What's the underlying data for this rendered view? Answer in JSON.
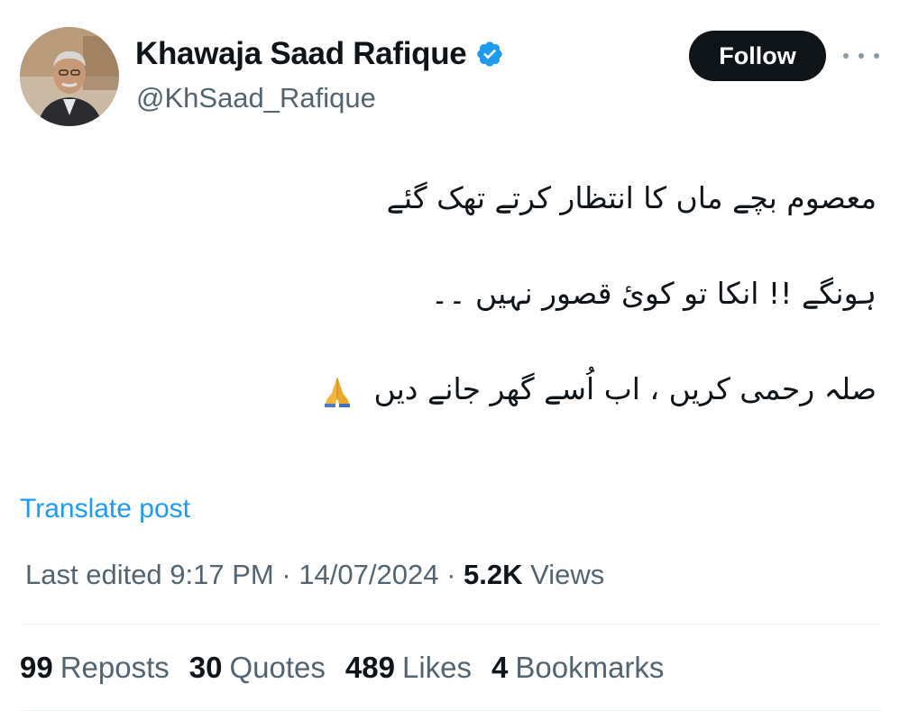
{
  "author": {
    "display_name": "Khawaja Saad Rafique",
    "handle": "@KhSaad_Rafique",
    "verified_icon": "verified-badge-icon",
    "verified_color": "#1d9bf0"
  },
  "actions": {
    "follow_label": "Follow",
    "more_icon": "more-horizontal-icon"
  },
  "tweet": {
    "lines": [
      "معصوم بچے ماں کا انتظار کرتے  تھک گئے",
      "ہونگے !! انکا تو کوئ قصور نہیں ۔۔",
      "صلہ رحمی کریں  ،  اب اُسے گھر جانے دیں"
    ],
    "emoji": "folded-hands-emoji"
  },
  "translate_label": "Translate post",
  "meta": {
    "edited_prefix": "Last edited ",
    "time": "9:17 PM",
    "separator1": " · ",
    "date": "14/07/2024",
    "separator2": " · ",
    "views_count": "5.2K",
    "views_label": " Views"
  },
  "stats": {
    "reposts": {
      "count": "99",
      "label": "Reposts"
    },
    "quotes": {
      "count": "30",
      "label": "Quotes"
    },
    "likes": {
      "count": "489",
      "label": "Likes"
    },
    "bookmarks": {
      "count": "4",
      "label": "Bookmarks"
    }
  },
  "colors": {
    "accent": "#1d9bf0",
    "text_primary": "#0f1419",
    "text_secondary": "#536471",
    "button_bg": "#0f1419"
  }
}
